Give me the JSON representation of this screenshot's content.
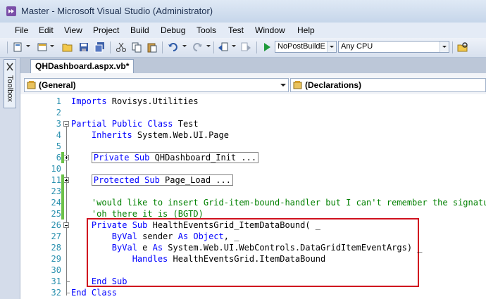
{
  "window": {
    "title": "Master - Microsoft Visual Studio (Administrator)"
  },
  "menu": [
    "File",
    "Edit",
    "View",
    "Project",
    "Build",
    "Debug",
    "Tools",
    "Test",
    "Window",
    "Help"
  ],
  "toolbar": {
    "configuration": "NoPostBuildE",
    "platform": "Any CPU"
  },
  "toolbox": {
    "label": "Toolbox"
  },
  "document_tab": {
    "label": "QHDashboard.aspx.vb*"
  },
  "navigation": {
    "left": "(General)",
    "right": "(Declarations)"
  },
  "code_lines": [
    {
      "num": "1",
      "parts": [
        [
          "kw",
          "Imports"
        ],
        [
          "cb",
          " Rovisys.Utilities"
        ]
      ]
    },
    {
      "num": "2",
      "parts": []
    },
    {
      "num": "3",
      "parts": [
        [
          "kw",
          "Partial Public Class"
        ],
        [
          "cb",
          " Test"
        ]
      ]
    },
    {
      "num": "4",
      "parts": [
        [
          "cb",
          "    "
        ],
        [
          "kw",
          "Inherits"
        ],
        [
          "cb",
          " System.Web.UI.Page"
        ]
      ]
    },
    {
      "num": "5",
      "parts": []
    },
    {
      "num": "6",
      "parts": [
        [
          "cb",
          "    "
        ],
        [
          "kwbox",
          "Private Sub"
        ],
        [
          "cbbox",
          " QHDashboard_Init ..."
        ]
      ]
    },
    {
      "num": "10",
      "parts": []
    },
    {
      "num": "11",
      "parts": [
        [
          "cb",
          "    "
        ],
        [
          "kwbox",
          "Protected Sub"
        ],
        [
          "cbbox",
          " Page_Load ..."
        ]
      ]
    },
    {
      "num": "23",
      "parts": []
    },
    {
      "num": "24",
      "parts": [
        [
          "cb",
          "    "
        ],
        [
          "cm",
          "'would like to insert Grid-item-bound-handler but I can't remember the signature"
        ]
      ]
    },
    {
      "num": "25",
      "parts": [
        [
          "cb",
          "    "
        ],
        [
          "cm",
          "'oh there it is (BGTD)"
        ]
      ]
    },
    {
      "num": "26",
      "parts": [
        [
          "cb",
          "    "
        ],
        [
          "kw",
          "Private Sub"
        ],
        [
          "cb",
          " HealthEventsGrid_ItemDataBound( _"
        ]
      ]
    },
    {
      "num": "27",
      "parts": [
        [
          "cb",
          "        "
        ],
        [
          "kw",
          "ByVal"
        ],
        [
          "cb",
          " sender "
        ],
        [
          "kw",
          "As Object"
        ],
        [
          "cb",
          ", _"
        ]
      ]
    },
    {
      "num": "28",
      "parts": [
        [
          "cb",
          "        "
        ],
        [
          "kw",
          "ByVal"
        ],
        [
          "cb",
          " e "
        ],
        [
          "kw",
          "As"
        ],
        [
          "cb",
          " System.Web.UI.WebControls.DataGridItemEventArgs) _"
        ]
      ]
    },
    {
      "num": "29",
      "parts": [
        [
          "cb",
          "            "
        ],
        [
          "kw",
          "Handles"
        ],
        [
          "cb",
          " HealthEventsGrid.ItemDataBound"
        ]
      ]
    },
    {
      "num": "30",
      "parts": []
    },
    {
      "num": "31",
      "parts": [
        [
          "cb",
          "    "
        ],
        [
          "kw",
          "End Sub"
        ]
      ]
    },
    {
      "num": "32",
      "parts": [
        [
          "kw",
          "End Class"
        ]
      ]
    }
  ]
}
